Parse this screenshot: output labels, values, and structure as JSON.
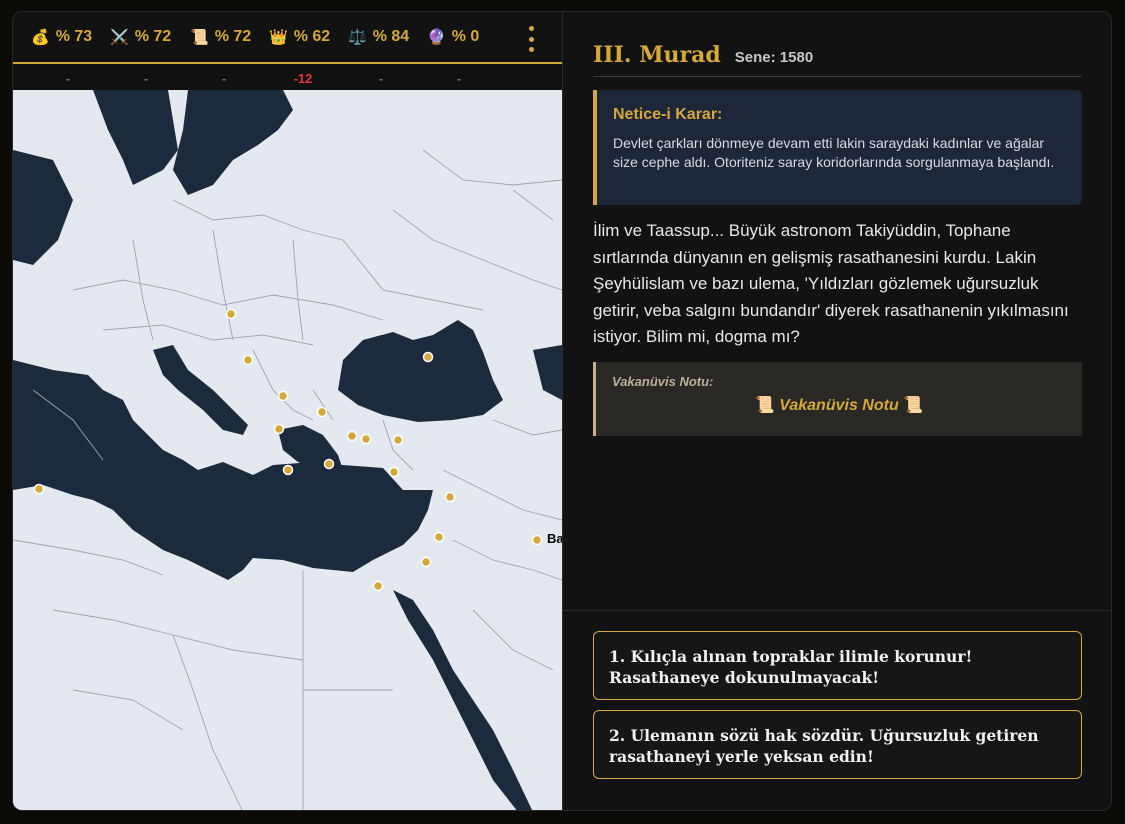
{
  "stats": [
    {
      "icon_name": "money-bag-icon",
      "glyph": "💰",
      "value": "% 73",
      "delta": "-"
    },
    {
      "icon_name": "crossed-swords-icon",
      "glyph": "⚔️",
      "value": "% 72",
      "delta": "-"
    },
    {
      "icon_name": "scroll-icon",
      "glyph": "📜",
      "value": "% 72",
      "delta": "-"
    },
    {
      "icon_name": "crown-icon",
      "glyph": "👑",
      "value": "% 62",
      "delta": "-12"
    },
    {
      "icon_name": "balance-scale-icon",
      "glyph": "⚖️",
      "value": "% 84",
      "delta": "-"
    },
    {
      "icon_name": "crystal-ball-icon",
      "glyph": "🔮",
      "value": "% 0",
      "delta": "-"
    }
  ],
  "map": {
    "city_label": "Ba"
  },
  "header": {
    "sultan": "III. Murad",
    "year": "Sene: 1580"
  },
  "result": {
    "title": "Netice-i Karar:",
    "text": "Devlet çarkları dönmeye devam etti lakin saraydaki kadınlar ve ağalar size cephe aldı. Otoriteniz saray koridorlarında sorgulanmaya başlandı."
  },
  "story": "İlim ve Taassup... Büyük astronom Takiyüddin, Tophane sırtlarında dünyanın en gelişmiş rasathanesini kurdu. Lakin Şeyhülislam ve bazı ulema, 'Yıldızları gözlemek uğursuzluk getirir, veba salgını bundandır' diyerek rasathanenin yıkılmasını istiyor. Bilim mi, dogma mı?",
  "note": {
    "label": "Vakanüvis Notu:",
    "button": "Vakanüvis Notu",
    "icon_name": "scroll-icon"
  },
  "choices": [
    {
      "text": "1. Kılıçla alınan topraklar ilimle korunur! Rasathaneye dokunulmayacak!"
    },
    {
      "text": "2. Ulemanın sözü hak sözdür. Uğursuzluk getiren rasathaneyi yerle yeksan edin!"
    }
  ],
  "colors": {
    "accent_gold": "#d4a93a",
    "negative_red": "#e03a3a",
    "sea_navy": "#1b2a3d",
    "land_light": "#e4e9f0",
    "result_bg": "#1e2639"
  }
}
